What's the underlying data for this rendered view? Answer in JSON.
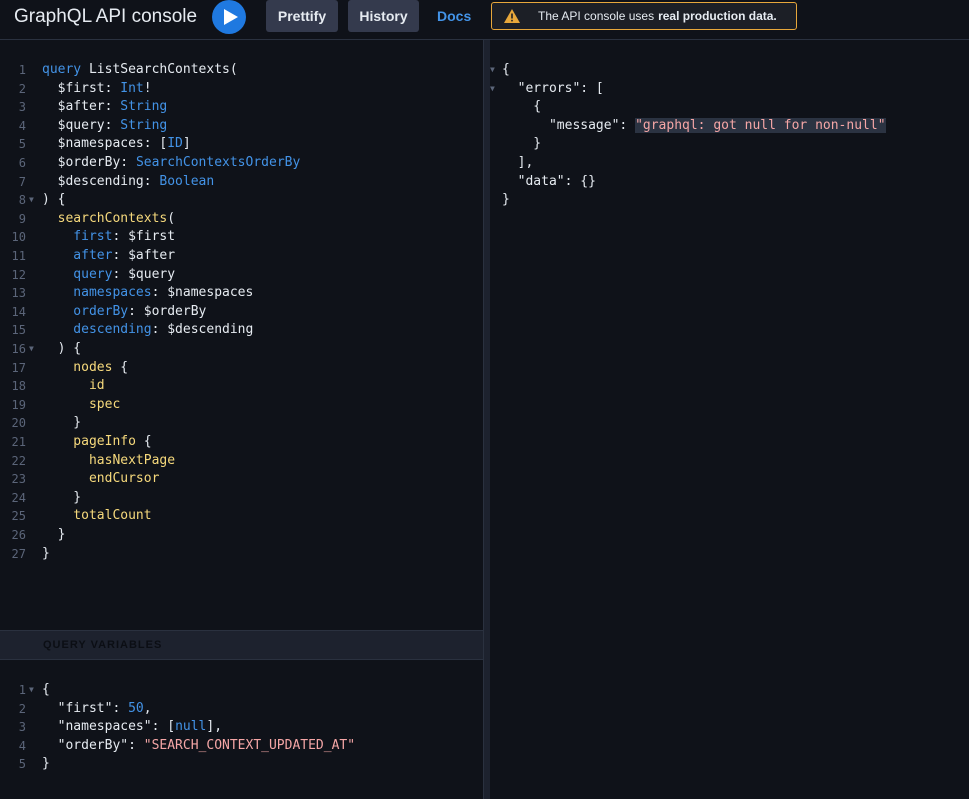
{
  "header": {
    "title": "GraphQL API console",
    "prettify_label": "Prettify",
    "history_label": "History",
    "docs_label": "Docs",
    "warning_prefix": "The API console uses",
    "warning_bold": "real production data."
  },
  "colors": {
    "accent": "#1f79e0",
    "warning_border": "#e7a73b",
    "keyword": "#4393e7",
    "field": "#f6d97c",
    "string": "#f5a6a6"
  },
  "query_editor": {
    "lines": [
      [
        [
          "kw",
          "query"
        ],
        [
          "def",
          " ListSearchContexts("
        ]
      ],
      [
        [
          "var",
          "  $first"
        ],
        [
          "punc",
          ": "
        ],
        [
          "type",
          "Int"
        ],
        [
          "punc",
          "!"
        ]
      ],
      [
        [
          "var",
          "  $after"
        ],
        [
          "punc",
          ": "
        ],
        [
          "type",
          "String"
        ]
      ],
      [
        [
          "var",
          "  $query"
        ],
        [
          "punc",
          ": "
        ],
        [
          "type",
          "String"
        ]
      ],
      [
        [
          "var",
          "  $namespaces"
        ],
        [
          "punc",
          ": ["
        ],
        [
          "type",
          "ID"
        ],
        [
          "punc",
          "]"
        ]
      ],
      [
        [
          "var",
          "  $orderBy"
        ],
        [
          "punc",
          ": "
        ],
        [
          "type",
          "SearchContextsOrderBy"
        ]
      ],
      [
        [
          "var",
          "  $descending"
        ],
        [
          "punc",
          ": "
        ],
        [
          "type",
          "Boolean"
        ]
      ],
      [
        [
          "punc",
          ") {"
        ]
      ],
      [
        [
          "field",
          "  searchContexts"
        ],
        [
          "punc",
          "("
        ]
      ],
      [
        [
          "arg",
          "    first"
        ],
        [
          "punc",
          ": "
        ],
        [
          "var",
          "$first"
        ]
      ],
      [
        [
          "arg",
          "    after"
        ],
        [
          "punc",
          ": "
        ],
        [
          "var",
          "$after"
        ]
      ],
      [
        [
          "arg",
          "    query"
        ],
        [
          "punc",
          ": "
        ],
        [
          "var",
          "$query"
        ]
      ],
      [
        [
          "arg",
          "    namespaces"
        ],
        [
          "punc",
          ": "
        ],
        [
          "var",
          "$namespaces"
        ]
      ],
      [
        [
          "arg",
          "    orderBy"
        ],
        [
          "punc",
          ": "
        ],
        [
          "var",
          "$orderBy"
        ]
      ],
      [
        [
          "arg",
          "    descending"
        ],
        [
          "punc",
          ": "
        ],
        [
          "var",
          "$descending"
        ]
      ],
      [
        [
          "punc",
          "  ) {"
        ]
      ],
      [
        [
          "field",
          "    nodes"
        ],
        [
          "punc",
          " {"
        ]
      ],
      [
        [
          "field",
          "      id"
        ]
      ],
      [
        [
          "field",
          "      spec"
        ]
      ],
      [
        [
          "punc",
          "    }"
        ]
      ],
      [
        [
          "field",
          "    pageInfo"
        ],
        [
          "punc",
          " {"
        ]
      ],
      [
        [
          "field",
          "      hasNextPage"
        ]
      ],
      [
        [
          "field",
          "      endCursor"
        ]
      ],
      [
        [
          "punc",
          "    }"
        ]
      ],
      [
        [
          "field",
          "    totalCount"
        ]
      ],
      [
        [
          "punc",
          "  }"
        ]
      ],
      [
        [
          "punc",
          "}"
        ]
      ]
    ],
    "line_numbers": [
      "1",
      "2",
      "3",
      "4",
      "5",
      "6",
      "7",
      "8",
      "9",
      "10",
      "11",
      "12",
      "13",
      "14",
      "15",
      "16",
      "17",
      "18",
      "19",
      "20",
      "21",
      "22",
      "23",
      "24",
      "25",
      "26",
      "27"
    ],
    "fold_lines": [
      8,
      16
    ]
  },
  "variables_panel": {
    "header": "QUERY VARIABLES",
    "lines": [
      [
        [
          "punc",
          "{"
        ]
      ],
      [
        [
          "key",
          "  \"first\""
        ],
        [
          "punc",
          ": "
        ],
        [
          "num",
          "50"
        ],
        [
          "punc",
          ","
        ]
      ],
      [
        [
          "key",
          "  \"namespaces\""
        ],
        [
          "punc",
          ": ["
        ],
        [
          "num",
          "null"
        ],
        [
          "punc",
          "],"
        ]
      ],
      [
        [
          "key",
          "  \"orderBy\""
        ],
        [
          "punc",
          ": "
        ],
        [
          "str",
          "\"SEARCH_CONTEXT_UPDATED_AT\""
        ]
      ],
      [
        [
          "punc",
          "}"
        ]
      ]
    ],
    "line_numbers": [
      "1",
      "2",
      "3",
      "4",
      "5"
    ],
    "fold_lines": [
      1
    ]
  },
  "result_panel": {
    "lines": [
      [
        [
          "punc",
          "{"
        ]
      ],
      [
        [
          "key",
          "  \"errors\""
        ],
        [
          "punc",
          ": ["
        ]
      ],
      [
        [
          "punc",
          "    {"
        ]
      ],
      [
        [
          "key",
          "      \"message\""
        ],
        [
          "punc",
          ": "
        ],
        [
          "str",
          "\"graphql: got null for non-null\""
        ]
      ],
      [
        [
          "punc",
          "    }"
        ]
      ],
      [
        [
          "punc",
          "  ],"
        ]
      ],
      [
        [
          "key",
          "  \"data\""
        ],
        [
          "punc",
          ": {}"
        ]
      ],
      [
        [
          "punc",
          "}"
        ]
      ]
    ],
    "fold_lines": [
      1,
      2
    ]
  }
}
